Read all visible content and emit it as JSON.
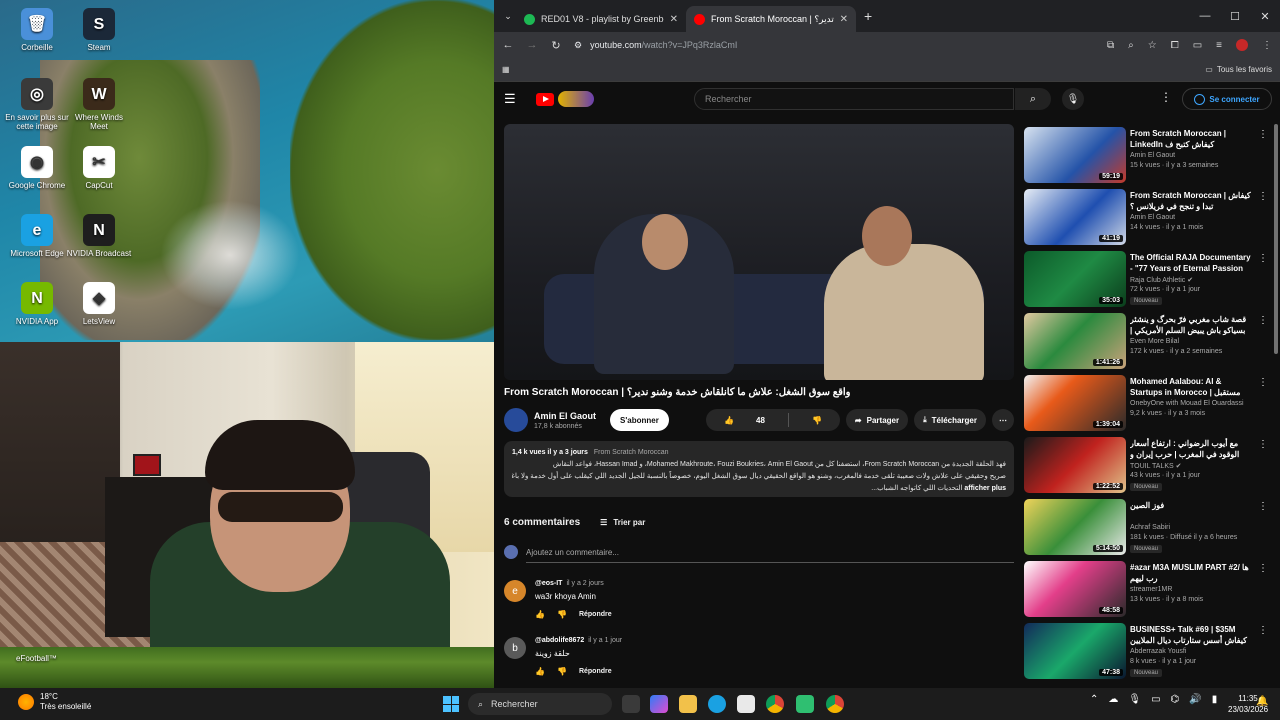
{
  "desktop": {
    "icons": [
      {
        "label": "Corbeille",
        "icon": "recycle-bin-icon",
        "color": "#4a90d9",
        "glyph": "🗑"
      },
      {
        "label": "Steam",
        "icon": "steam-icon",
        "color": "#1b2838",
        "glyph": "S"
      },
      {
        "label": "En savoir plus sur cette image",
        "icon": "info-camera-icon",
        "color": "#3a3a3a",
        "glyph": "◎"
      },
      {
        "label": "Where Winds Meet",
        "icon": "game-icon",
        "color": "#3b2a1a",
        "glyph": "W"
      },
      {
        "label": "Google Chrome",
        "icon": "chrome-icon",
        "color": "#ffffff",
        "glyph": "◉"
      },
      {
        "label": "CapCut",
        "icon": "capcut-icon",
        "color": "#ffffff",
        "glyph": "✂"
      },
      {
        "label": "Microsoft Edge",
        "icon": "edge-icon",
        "color": "#1aa1e2",
        "glyph": "e"
      },
      {
        "label": "NVIDIA Broadcast",
        "icon": "nvidia-broadcast-icon",
        "color": "#1e1e1e",
        "glyph": "N"
      },
      {
        "label": "NVIDIA App",
        "icon": "nvidia-icon",
        "color": "#76b900",
        "glyph": "N"
      },
      {
        "label": "LetsView",
        "icon": "letsview-icon",
        "color": "#ffffff",
        "glyph": "◈"
      }
    ],
    "efootball_label": "eFootball™"
  },
  "browser": {
    "tabs": [
      {
        "title": "RED01 V8 - playlist by Greenbe",
        "favicon_color": "#1db954",
        "active": false
      },
      {
        "title": "From Scratch Moroccan | تدير؟",
        "favicon_color": "#ff0000",
        "active": true
      }
    ],
    "new_tab": "+",
    "window_controls": [
      "—",
      "☐",
      "✕"
    ],
    "url_site": "youtube.com",
    "url_path": "/watch?v=JPq3RzlaCmI",
    "bookmarks_all": "Tous les favoris"
  },
  "youtube": {
    "search_placeholder": "Rechercher",
    "signin_label": "Se connecter",
    "video_title": "From Scratch Moroccan | واقع سوق الشغل: علاش ما كانلقاش خدمة وشنو ندير؟",
    "channel_name": "Amin El Gaout",
    "channel_subs": "17,8 k abonnés",
    "subscribe_label": "S'abonner",
    "likes": "48",
    "share_label": "Partager",
    "download_label": "Télécharger",
    "desc_meta": "1,4 k vues  il y a 3 jours",
    "desc_tag": "From Scratch Moroccan",
    "desc_line1": "فهذ الحلقة الجديدة من From Scratch Moroccan، استضفنا كل من Mohamed Makhroute، Fouzi Boukries، Amin El Gaout، و Hassan Imad، فواعد النقاش",
    "desc_line2": "صريح وحقيقي على علاش ولات صعيبة تلقى خدمة فالمغرب، وشنو هو الواقع الحقيقي ديال سوق الشغل اليوم، خصوصاً بالنسبة للجيل الجديد اللي كيقلب على أول خدمة ولا باغي يبني مستقبل",
    "desc_line3": "التحديات اللي كاتواجه الشباب...",
    "desc_more": "afficher plus",
    "comments_count": "6 commentaires",
    "sort_label": "Trier par",
    "add_comment_placeholder": "Ajoutez un commentaire...",
    "comments": [
      {
        "author": "@eos-IT",
        "ago": "il y a 2 jours",
        "text": "wa3r khoya Amin",
        "reply": "Répondre",
        "avatar_color": "#d6862a",
        "initial": "e"
      },
      {
        "author": "@abdolife8672",
        "ago": "il y a 1 jour",
        "text": "حلقة زوينة",
        "reply": "Répondre",
        "avatar_color": "#5a5a5a",
        "initial": "b"
      }
    ],
    "recommendations": [
      {
        "title": "From Scratch Moroccan | LinkedIn كيفاش كتبح ف",
        "channel": "Amin El Gaout",
        "meta": "15 k vues · il y a 3 semaines",
        "duration": "59:19",
        "badge": "",
        "thumb": "linear-gradient(135deg,#d8e3f0,#2453a8 60%,#c43a2a)"
      },
      {
        "title": "From Scratch Moroccan | كيفاش تبدا و تنجح في فريلانس ؟",
        "channel": "Amin El Gaout",
        "meta": "14 k vues · il y a 1 mois",
        "duration": "41:19",
        "badge": "",
        "thumb": "linear-gradient(135deg,#e7edf5,#1f4fb0 55%,#d0d8e6)"
      },
      {
        "title": "The Official RAJA Documentary - \"77 Years of Eternal Passion",
        "channel": "Raja Club Athletic ✔",
        "meta": "72 k vues · il y a 1 jour",
        "duration": "35:03",
        "badge": "Nouveau",
        "thumb": "linear-gradient(135deg,#0c5a2a,#1f8a44 50%,#0b3d1c)"
      },
      {
        "title": "قصة شاب مغربي فرّ بحرگ و ينشئر بسياكو باش يبيض السلم الأمريكي | يتكل بلكين",
        "channel": "Even More Bilal",
        "meta": "172 k vues · il y a 2 semaines",
        "duration": "1:41:26",
        "badge": "",
        "thumb": "linear-gradient(135deg,#e2c9a0,#2b8a3e 45%,#c9a27a)"
      },
      {
        "title": "Mohamed Aalabou: AI & Startups in Morocco | مستقبل الذكاء",
        "channel": "OnebyOne with Mouad El Ouardassi",
        "meta": "9,2 k vues · il y a 3 mois",
        "duration": "1:39:04",
        "badge": "",
        "thumb": "linear-gradient(135deg,#f2f2f2,#e85a1a 35%,#2a2a2a)"
      },
      {
        "title": "مع أيوب الرضواني : ارتفاع أسعار الوقود في المغرب | حرب إيران و إنعكاساتها",
        "channel": "TOUIL TALKS ✔",
        "meta": "43 k vues · il y a 1 jour",
        "duration": "1:22:52",
        "badge": "Nouveau",
        "thumb": "linear-gradient(135deg,#1a1a1a,#c0221e 50%,#e0c38a)"
      },
      {
        "title": "فوز الصين",
        "channel": "Achraf Sabiri",
        "meta": "181 k vues · Diffusé il y a 6 heures",
        "duration": "5:14:50",
        "badge": "Nouveau",
        "thumb": "linear-gradient(135deg,#f0d35a,#3a8f3a 50%,#e9e9e9)"
      },
      {
        "title": "#azar M3A MUSLIM PART #2/ ها رب ليهم",
        "channel": "streamer1MR",
        "meta": "13 k vues · il y a 8 mois",
        "duration": "48:58",
        "badge": "",
        "thumb": "linear-gradient(135deg,#ffffff,#e33f8a 40%,#2a2a2a)"
      },
      {
        "title": "BUSINESS+ Talk #69 | $35M كيفاش أسس ستارتاب ديال الملايين",
        "channel": "Abderrazak Yousfi",
        "meta": "8 k vues · il y a 1 jour",
        "duration": "47:38",
        "badge": "Nouveau",
        "thumb": "linear-gradient(135deg,#122a5a,#1aa86a 50%,#0a1630)"
      }
    ]
  },
  "taskbar": {
    "temp": "18°C",
    "weather": "Très ensoleillé",
    "search_label": "Rechercher",
    "time": "11:35",
    "date": "23/03/2026"
  }
}
